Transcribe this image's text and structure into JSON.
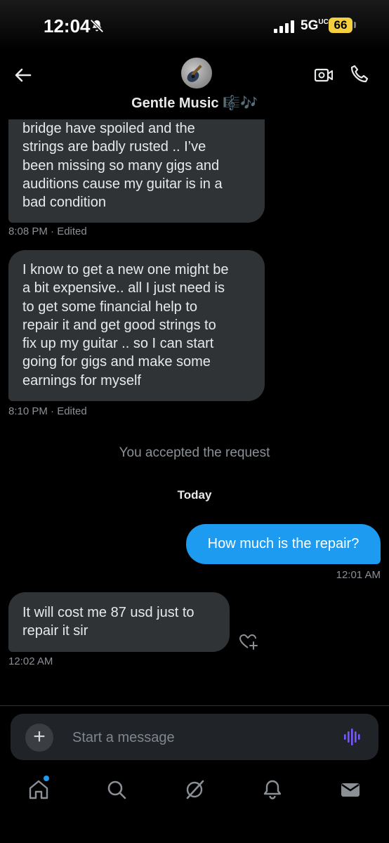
{
  "status_bar": {
    "time": "12:04",
    "network": "5G",
    "network_sub": "UC",
    "battery": "66"
  },
  "header": {
    "contact_name": "Gentle Music 🎼🎶",
    "back_icon": "arrow-left-icon",
    "video_icon": "video-camera-icon",
    "call_icon": "phone-icon"
  },
  "messages": [
    {
      "direction": "in",
      "lines": [
        "bridge have spoiled and the",
        "strings are badly rusted .. I’ve",
        "been missing so many gigs and",
        "auditions cause my guitar is in a",
        "bad condition"
      ],
      "meta": "8:08 PM · Edited"
    },
    {
      "direction": "in",
      "lines": [
        "I know to get a new one might be",
        "a bit expensive.. all I just need  is",
        "to get some financial help to",
        "repair it and get good strings to",
        "fix up my guitar .. so I can start",
        "going for gigs and make some",
        "earnings for myself"
      ],
      "meta": "8:10 PM · Edited"
    }
  ],
  "system_note": "You accepted the request",
  "day_separator": "Today",
  "outgoing": {
    "text": "How much is the repair?",
    "meta": "12:01 AM"
  },
  "last_incoming": {
    "lines": [
      "It will cost me 87 usd just to",
      "repair it sir"
    ],
    "meta": "12:02 AM"
  },
  "composer": {
    "placeholder": "Start a message"
  },
  "tabs": [
    "home-icon",
    "search-icon",
    "grok-icon",
    "notifications-icon",
    "messages-icon"
  ],
  "colors": {
    "accent": "#1d9bf0",
    "bubble_in": "#2f3336",
    "voice": "#7856ff"
  }
}
